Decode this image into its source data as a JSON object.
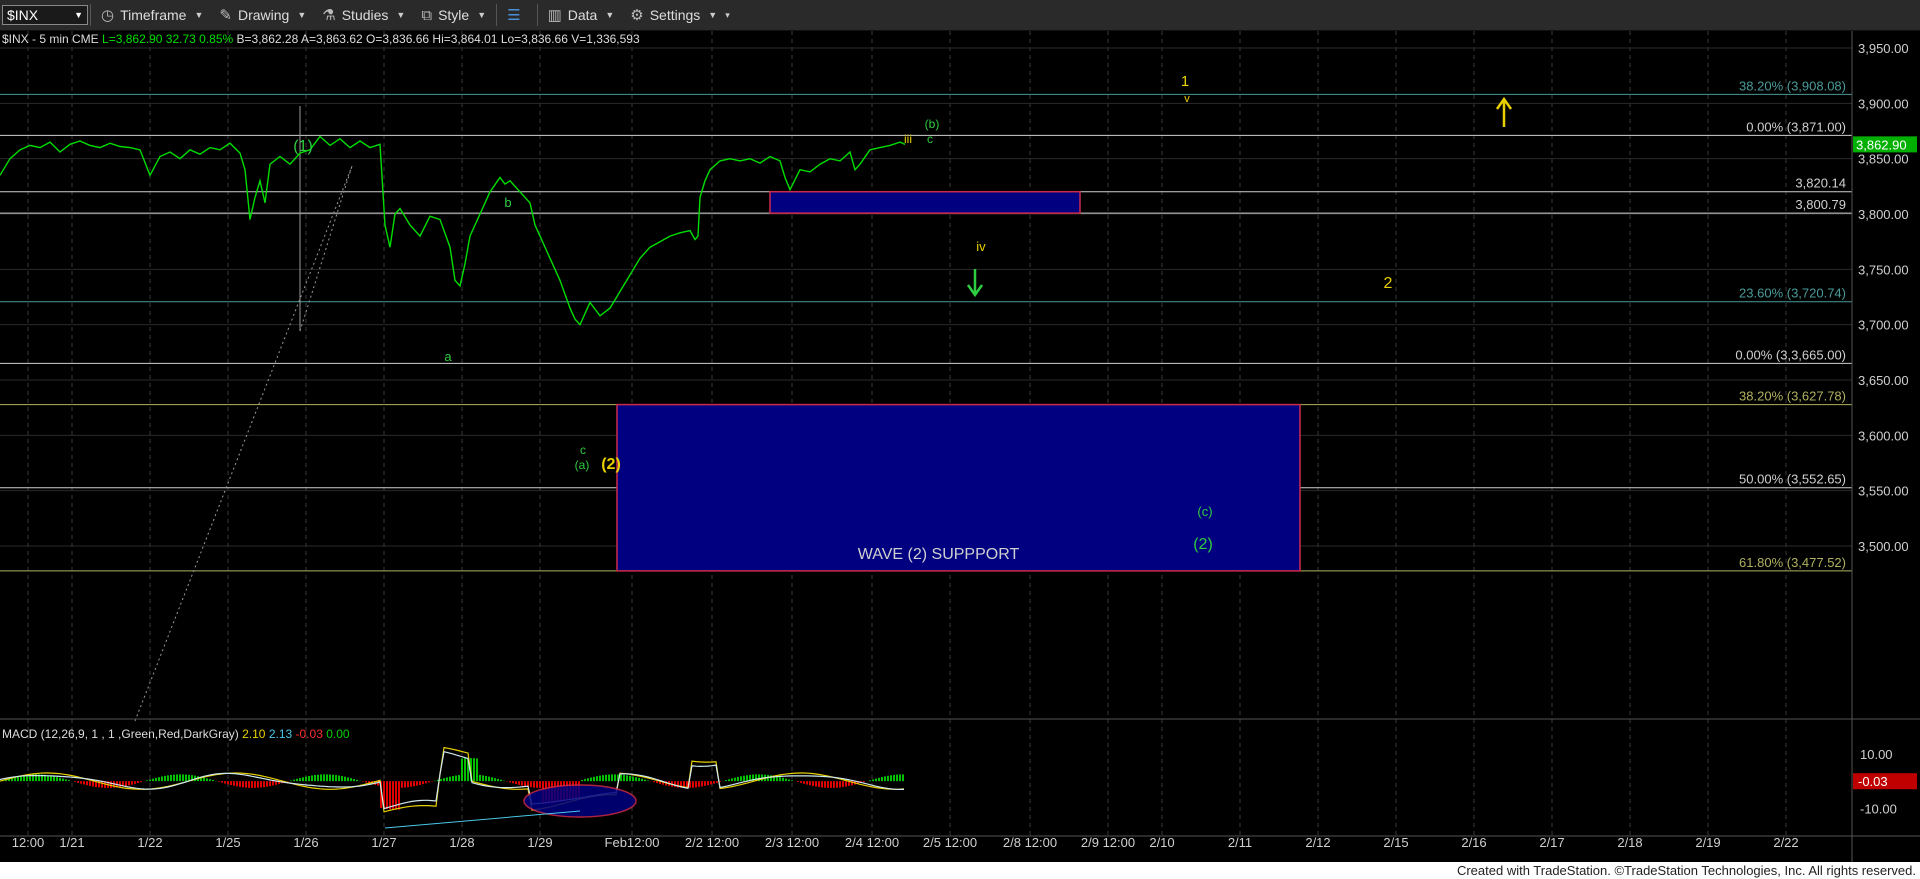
{
  "toolbar": {
    "symbol": "$INX",
    "timeframe": "Timeframe",
    "drawing": "Drawing",
    "studies": "Studies",
    "style": "Style",
    "data": "Data",
    "settings": "Settings"
  },
  "header": {
    "name": "$INX - 5 min  CME",
    "last": "L=3,862.90",
    "change": "32.73",
    "pct": "0.85%",
    "bid": "B=3,862.28",
    "ask": "A=3,863.62",
    "open": "O=3,836.66",
    "high": "Hi=3,864.01",
    "low": "Lo=3,836.66",
    "volume": "V=1,336,593"
  },
  "macd_legend": {
    "label": "MACD (12,26,9, 1 , 1 ,Green,Red,DarkGray)",
    "v1": "2.10",
    "v2": "2.13",
    "v3": "-0.03",
    "v4": "0.00"
  },
  "footer": "Created with TradeStation. ©TradeStation Technologies, Inc. All rights reserved.",
  "colors": {
    "price": "#00dd00",
    "box": "#000080",
    "box_border": "#cc2a4a",
    "wave_yellow": "#e8d000",
    "wave_green": "#2ecc40"
  },
  "chart_data": {
    "type": "line",
    "y_axis": {
      "min": 3450,
      "max": 3970,
      "ticks": [
        3500,
        3550,
        3600,
        3650,
        3700,
        3750,
        3800,
        3850,
        3900,
        3950
      ],
      "tick_labels": [
        "3,500.00",
        "3,550.00",
        "3,600.00",
        "3,650.00",
        "3,700.00",
        "3,750.00",
        "3,800.00",
        "3,850.00",
        "3,900.00",
        "3,950.00"
      ],
      "last_price": 3862.9,
      "last_label": "3,862.90"
    },
    "x_axis": {
      "labels": [
        "12:00",
        "1/21",
        "1/22",
        "1/25",
        "1/26",
        "1/27",
        "1/28",
        "1/29",
        "Feb12:00",
        "2/2 12:00",
        "2/3 12:00",
        "2/4 12:00",
        "2/5 12:00",
        "2/8 12:00",
        "2/9 12:00",
        "2/10",
        "2/11",
        "2/12",
        "2/15",
        "2/16",
        "2/17",
        "2/18",
        "2/19",
        "2/22"
      ],
      "grid": true
    },
    "price_series": [
      [
        0,
        3835
      ],
      [
        10,
        3850
      ],
      [
        20,
        3858
      ],
      [
        30,
        3862
      ],
      [
        40,
        3860
      ],
      [
        50,
        3865
      ],
      [
        60,
        3856
      ],
      [
        70,
        3863
      ],
      [
        80,
        3866
      ],
      [
        90,
        3862
      ],
      [
        100,
        3860
      ],
      [
        110,
        3864
      ],
      [
        120,
        3861
      ],
      [
        130,
        3860
      ],
      [
        140,
        3858
      ],
      [
        150,
        3835
      ],
      [
        160,
        3852
      ],
      [
        170,
        3856
      ],
      [
        180,
        3850
      ],
      [
        190,
        3858
      ],
      [
        200,
        3854
      ],
      [
        210,
        3860
      ],
      [
        220,
        3858
      ],
      [
        230,
        3864
      ],
      [
        240,
        3855
      ],
      [
        245,
        3840
      ],
      [
        250,
        3795
      ],
      [
        255,
        3815
      ],
      [
        260,
        3830
      ],
      [
        265,
        3810
      ],
      [
        270,
        3845
      ],
      [
        280,
        3852
      ],
      [
        290,
        3845
      ],
      [
        300,
        3855
      ],
      [
        310,
        3858
      ],
      [
        320,
        3870
      ],
      [
        330,
        3862
      ],
      [
        340,
        3868
      ],
      [
        350,
        3860
      ],
      [
        360,
        3866
      ],
      [
        370,
        3860
      ],
      [
        380,
        3863
      ],
      [
        385,
        3790
      ],
      [
        390,
        3770
      ],
      [
        395,
        3800
      ],
      [
        400,
        3805
      ],
      [
        410,
        3790
      ],
      [
        420,
        3780
      ],
      [
        430,
        3798
      ],
      [
        440,
        3795
      ],
      [
        450,
        3770
      ],
      [
        455,
        3740
      ],
      [
        460,
        3735
      ],
      [
        465,
        3755
      ],
      [
        470,
        3780
      ],
      [
        480,
        3800
      ],
      [
        490,
        3820
      ],
      [
        500,
        3833
      ],
      [
        505,
        3827
      ],
      [
        510,
        3830
      ],
      [
        520,
        3820
      ],
      [
        530,
        3810
      ],
      [
        535,
        3790
      ],
      [
        540,
        3780
      ],
      [
        550,
        3760
      ],
      [
        560,
        3740
      ],
      [
        570,
        3715
      ],
      [
        575,
        3705
      ],
      [
        580,
        3700
      ],
      [
        590,
        3720
      ],
      [
        600,
        3708
      ],
      [
        610,
        3715
      ],
      [
        620,
        3730
      ],
      [
        630,
        3745
      ],
      [
        640,
        3760
      ],
      [
        650,
        3770
      ],
      [
        660,
        3775
      ],
      [
        670,
        3780
      ],
      [
        680,
        3783
      ],
      [
        690,
        3785
      ],
      [
        695,
        3777
      ],
      [
        698,
        3780
      ],
      [
        700,
        3815
      ],
      [
        705,
        3830
      ],
      [
        710,
        3840
      ],
      [
        720,
        3848
      ],
      [
        730,
        3850
      ],
      [
        740,
        3848
      ],
      [
        750,
        3850
      ],
      [
        760,
        3846
      ],
      [
        770,
        3852
      ],
      [
        780,
        3848
      ],
      [
        785,
        3833
      ],
      [
        790,
        3822
      ],
      [
        800,
        3840
      ],
      [
        810,
        3838
      ],
      [
        820,
        3845
      ],
      [
        830,
        3850
      ],
      [
        840,
        3848
      ],
      [
        850,
        3856
      ],
      [
        855,
        3840
      ],
      [
        860,
        3845
      ],
      [
        870,
        3858
      ],
      [
        880,
        3860
      ],
      [
        890,
        3862
      ],
      [
        900,
        3865
      ],
      [
        905,
        3863
      ]
    ],
    "macd": {
      "ticks": [
        10,
        0,
        -10
      ],
      "tick_labels": [
        "10.00",
        "",
        "-10.00"
      ],
      "last_label": "-0.03",
      "min": -18,
      "max": 17
    },
    "horizontal_levels": [
      {
        "price": 3908.08,
        "label": "38.20% (3,908.08)",
        "color": "#4a9a9a"
      },
      {
        "price": 3871.0,
        "label": "0.00% (3,871.00)",
        "color": "#d0d0d0"
      },
      {
        "price": 3820.14,
        "label": "3,820.14",
        "color": "#d0d0d0"
      },
      {
        "price": 3800.79,
        "label": "3,800.79",
        "color": "#d0d0d0"
      },
      {
        "price": 3720.74,
        "label": "23.60% (3,720.74)",
        "color": "#4a9a9a"
      },
      {
        "price": 3665.0,
        "label": "0.00% (3,3,665.00)",
        "color": "#d0d0d0"
      },
      {
        "price": 3627.78,
        "label": "38.20% (3,627.78)",
        "color": "#b0b060"
      },
      {
        "price": 3552.65,
        "label": "50.00% (3,552.65)",
        "color": "#d0d0d0"
      },
      {
        "price": 3477.52,
        "label": "61.80% (3,477.52)",
        "color": "#b0b060"
      }
    ],
    "boxes": [
      {
        "price_top": 3820.14,
        "price_bottom": 3800.79,
        "label": ""
      },
      {
        "price_top": 3627.78,
        "price_bottom": 3477.52,
        "label": "WAVE (2) SUPPPORT"
      }
    ],
    "annotations": [
      {
        "text": "(1)",
        "color": "#2ecc40"
      },
      {
        "text": "b",
        "color": "#2ecc40"
      },
      {
        "text": "a",
        "color": "#2ecc40"
      },
      {
        "text": "c",
        "color": "#2ecc40"
      },
      {
        "text": "(a)",
        "color": "#2ecc40"
      },
      {
        "text": "(2)",
        "color": "#e8d000"
      },
      {
        "text": "iii",
        "color": "#e8d000"
      },
      {
        "text": "c",
        "color": "#2ecc40"
      },
      {
        "text": "(b)",
        "color": "#2ecc40"
      },
      {
        "text": "iv",
        "color": "#e8d000"
      },
      {
        "text": "1",
        "color": "#e8d000"
      },
      {
        "text": "v",
        "color": "#e8d000"
      },
      {
        "text": "2",
        "color": "#e8d000"
      },
      {
        "text": "(c)",
        "color": "#2ecc40"
      },
      {
        "text": "(2)",
        "color": "#2ecc40"
      }
    ]
  }
}
